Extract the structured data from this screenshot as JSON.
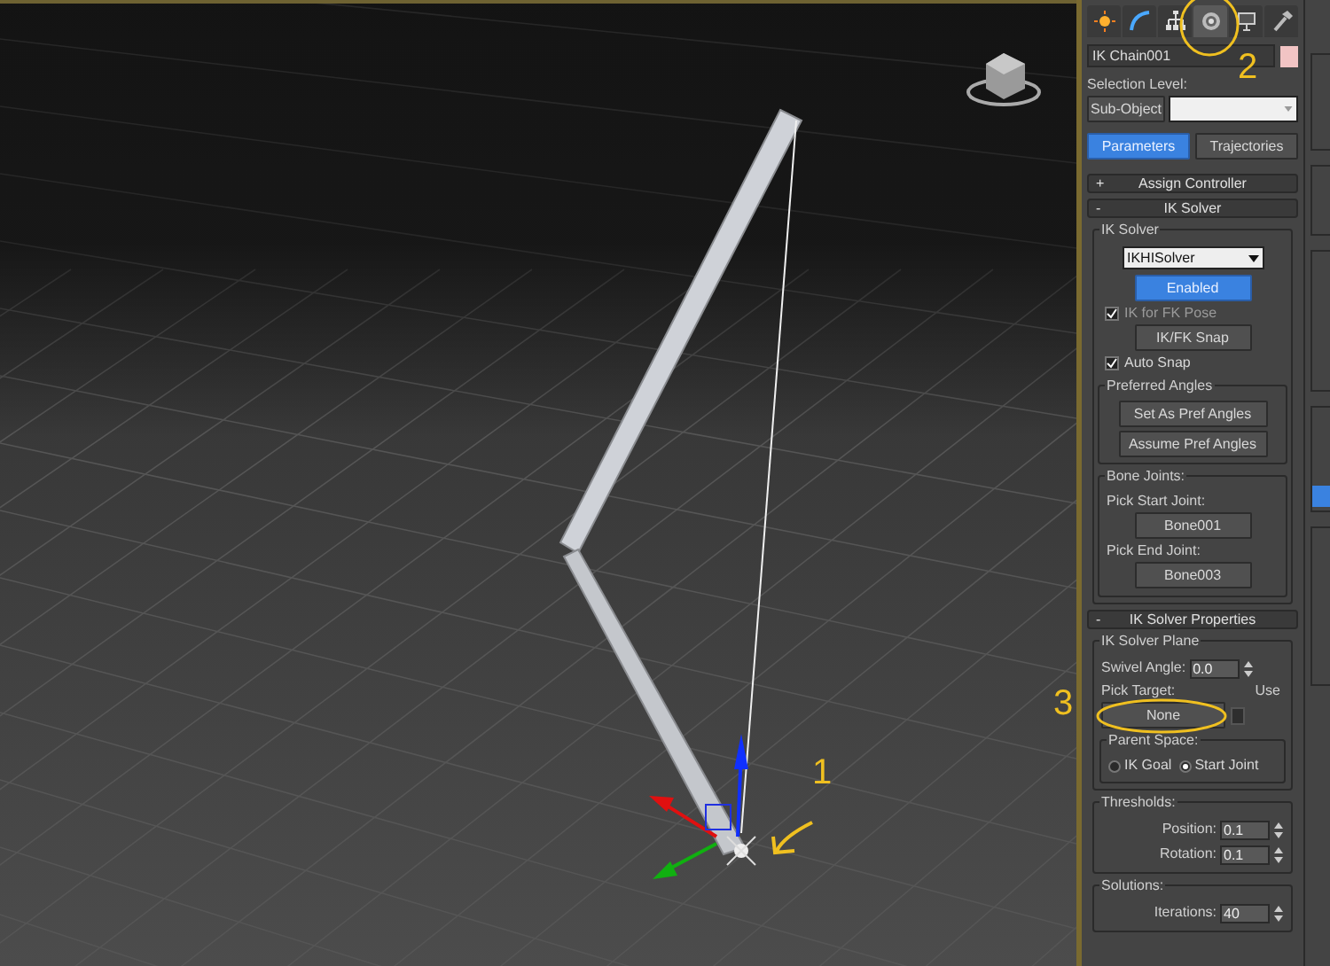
{
  "annotations": [
    {
      "text": "1"
    },
    {
      "text": "2"
    },
    {
      "text": "3"
    }
  ],
  "command_panel": {
    "tabs": [
      {
        "kind": "create",
        "selected": false
      },
      {
        "kind": "modify",
        "selected": false
      },
      {
        "kind": "hierarchy",
        "selected": false
      },
      {
        "kind": "motion",
        "selected": true
      },
      {
        "kind": "display",
        "selected": false
      },
      {
        "kind": "utilities",
        "selected": false
      }
    ],
    "object_name": "IK Chain001",
    "selection_level": {
      "label": "Selection Level:",
      "button": "Sub-Object"
    },
    "mode_buttons": [
      {
        "label": "Parameters",
        "selected": true
      },
      {
        "label": "Trajectories",
        "selected": false
      }
    ],
    "rollouts": [
      {
        "kind": "assign",
        "toggle": "+",
        "title": "Assign Controller"
      },
      {
        "kind": "ik_solver",
        "toggle": "-",
        "title": "IK Solver",
        "group_title": "IK Solver",
        "solver": "IKHISolver",
        "enabled_button": {
          "label": "Enabled",
          "on": true
        },
        "ik_for_fk_pose": {
          "label": "IK for FK Pose",
          "checked": true,
          "disabled": true
        },
        "snap_button": "IK/FK Snap",
        "auto_snap": {
          "label": "Auto Snap",
          "checked": true,
          "disabled": false
        },
        "preferred_angles": {
          "title": "Preferred Angles",
          "buttons": [
            "Set As Pref Angles",
            "Assume Pref Angles"
          ]
        },
        "bone_joints": {
          "title": "Bone Joints:",
          "start_label": "Pick Start Joint:",
          "start_button": "Bone001",
          "end_label": "Pick End Joint:",
          "end_button": "Bone003"
        }
      },
      {
        "kind": "ik_properties",
        "toggle": "-",
        "title": "IK Solver Properties",
        "plane": {
          "title": "IK Solver Plane",
          "swivel_label": "Swivel Angle:",
          "swivel_value": "0.0",
          "pick_target_label": "Pick Target:",
          "use_label": "Use",
          "target_button": "None",
          "use_checked": false,
          "parent_space": {
            "title": "Parent Space:",
            "options": [
              {
                "label": "IK Goal",
                "selected": false
              },
              {
                "label": "Start Joint",
                "selected": true
              }
            ]
          }
        },
        "thresholds": {
          "title": "Thresholds:",
          "fields": [
            {
              "label": "Position:",
              "value": "0.1"
            },
            {
              "label": "Rotation:",
              "value": "0.1"
            }
          ]
        },
        "solutions": {
          "title": "Solutions:",
          "fields": [
            {
              "label": "Iterations:",
              "value": "40"
            }
          ]
        }
      }
    ]
  }
}
